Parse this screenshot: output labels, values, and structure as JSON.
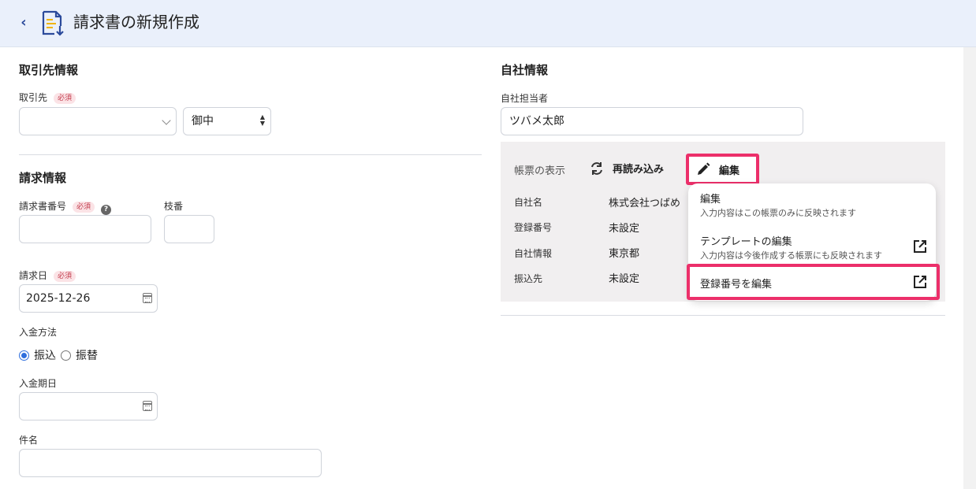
{
  "header": {
    "back_label": "‹",
    "title": "請求書の新規作成"
  },
  "client_section": {
    "title": "取引先情報",
    "client_label": "取引先",
    "required_badge": "必須",
    "client_value": "",
    "honorific_value": "御中"
  },
  "invoice_section": {
    "title": "請求情報",
    "invoice_number_label": "請求書番号",
    "required_badge": "必須",
    "help_glyph": "?",
    "branch_label": "枝番",
    "invoice_number_value": "",
    "branch_value": "",
    "date_label": "請求日",
    "date_required_badge": "必須",
    "date_value": "2025-12-26",
    "payment_method_label": "入金方法",
    "payment_options": [
      {
        "label": "振込",
        "selected": true
      },
      {
        "label": "振替",
        "selected": false
      }
    ],
    "due_date_label": "入金期日",
    "due_date_value": "",
    "subject_label": "件名",
    "subject_value": ""
  },
  "company_section": {
    "title": "自社情報",
    "person_label": "自社担当者",
    "person_value": "ツバメ太郎",
    "panel_title": "帳票の表示",
    "reload_label": "再読み込み",
    "edit_label": "編集",
    "rows": [
      {
        "key": "自社名",
        "value": "株式会社つばめ"
      },
      {
        "key": "登録番号",
        "value": "未設定"
      },
      {
        "key": "自社情報",
        "value": "東京都"
      },
      {
        "key": "振込先",
        "value": "未設定"
      }
    ]
  },
  "edit_menu": {
    "items": [
      {
        "label": "編集",
        "sub": "入力内容はこの帳票のみに反映されます"
      },
      {
        "label": "テンプレートの編集",
        "sub": "入力内容は今後作成する帳票にも反映されます"
      },
      {
        "label": "登録番号を編集",
        "sub": ""
      }
    ]
  },
  "colors": {
    "header_bg": "#eaf0fb",
    "accent": "#2b4a9b",
    "highlight": "#ec2f6a",
    "required_bg": "#fbe3e6",
    "required_fg": "#c23a4b"
  }
}
